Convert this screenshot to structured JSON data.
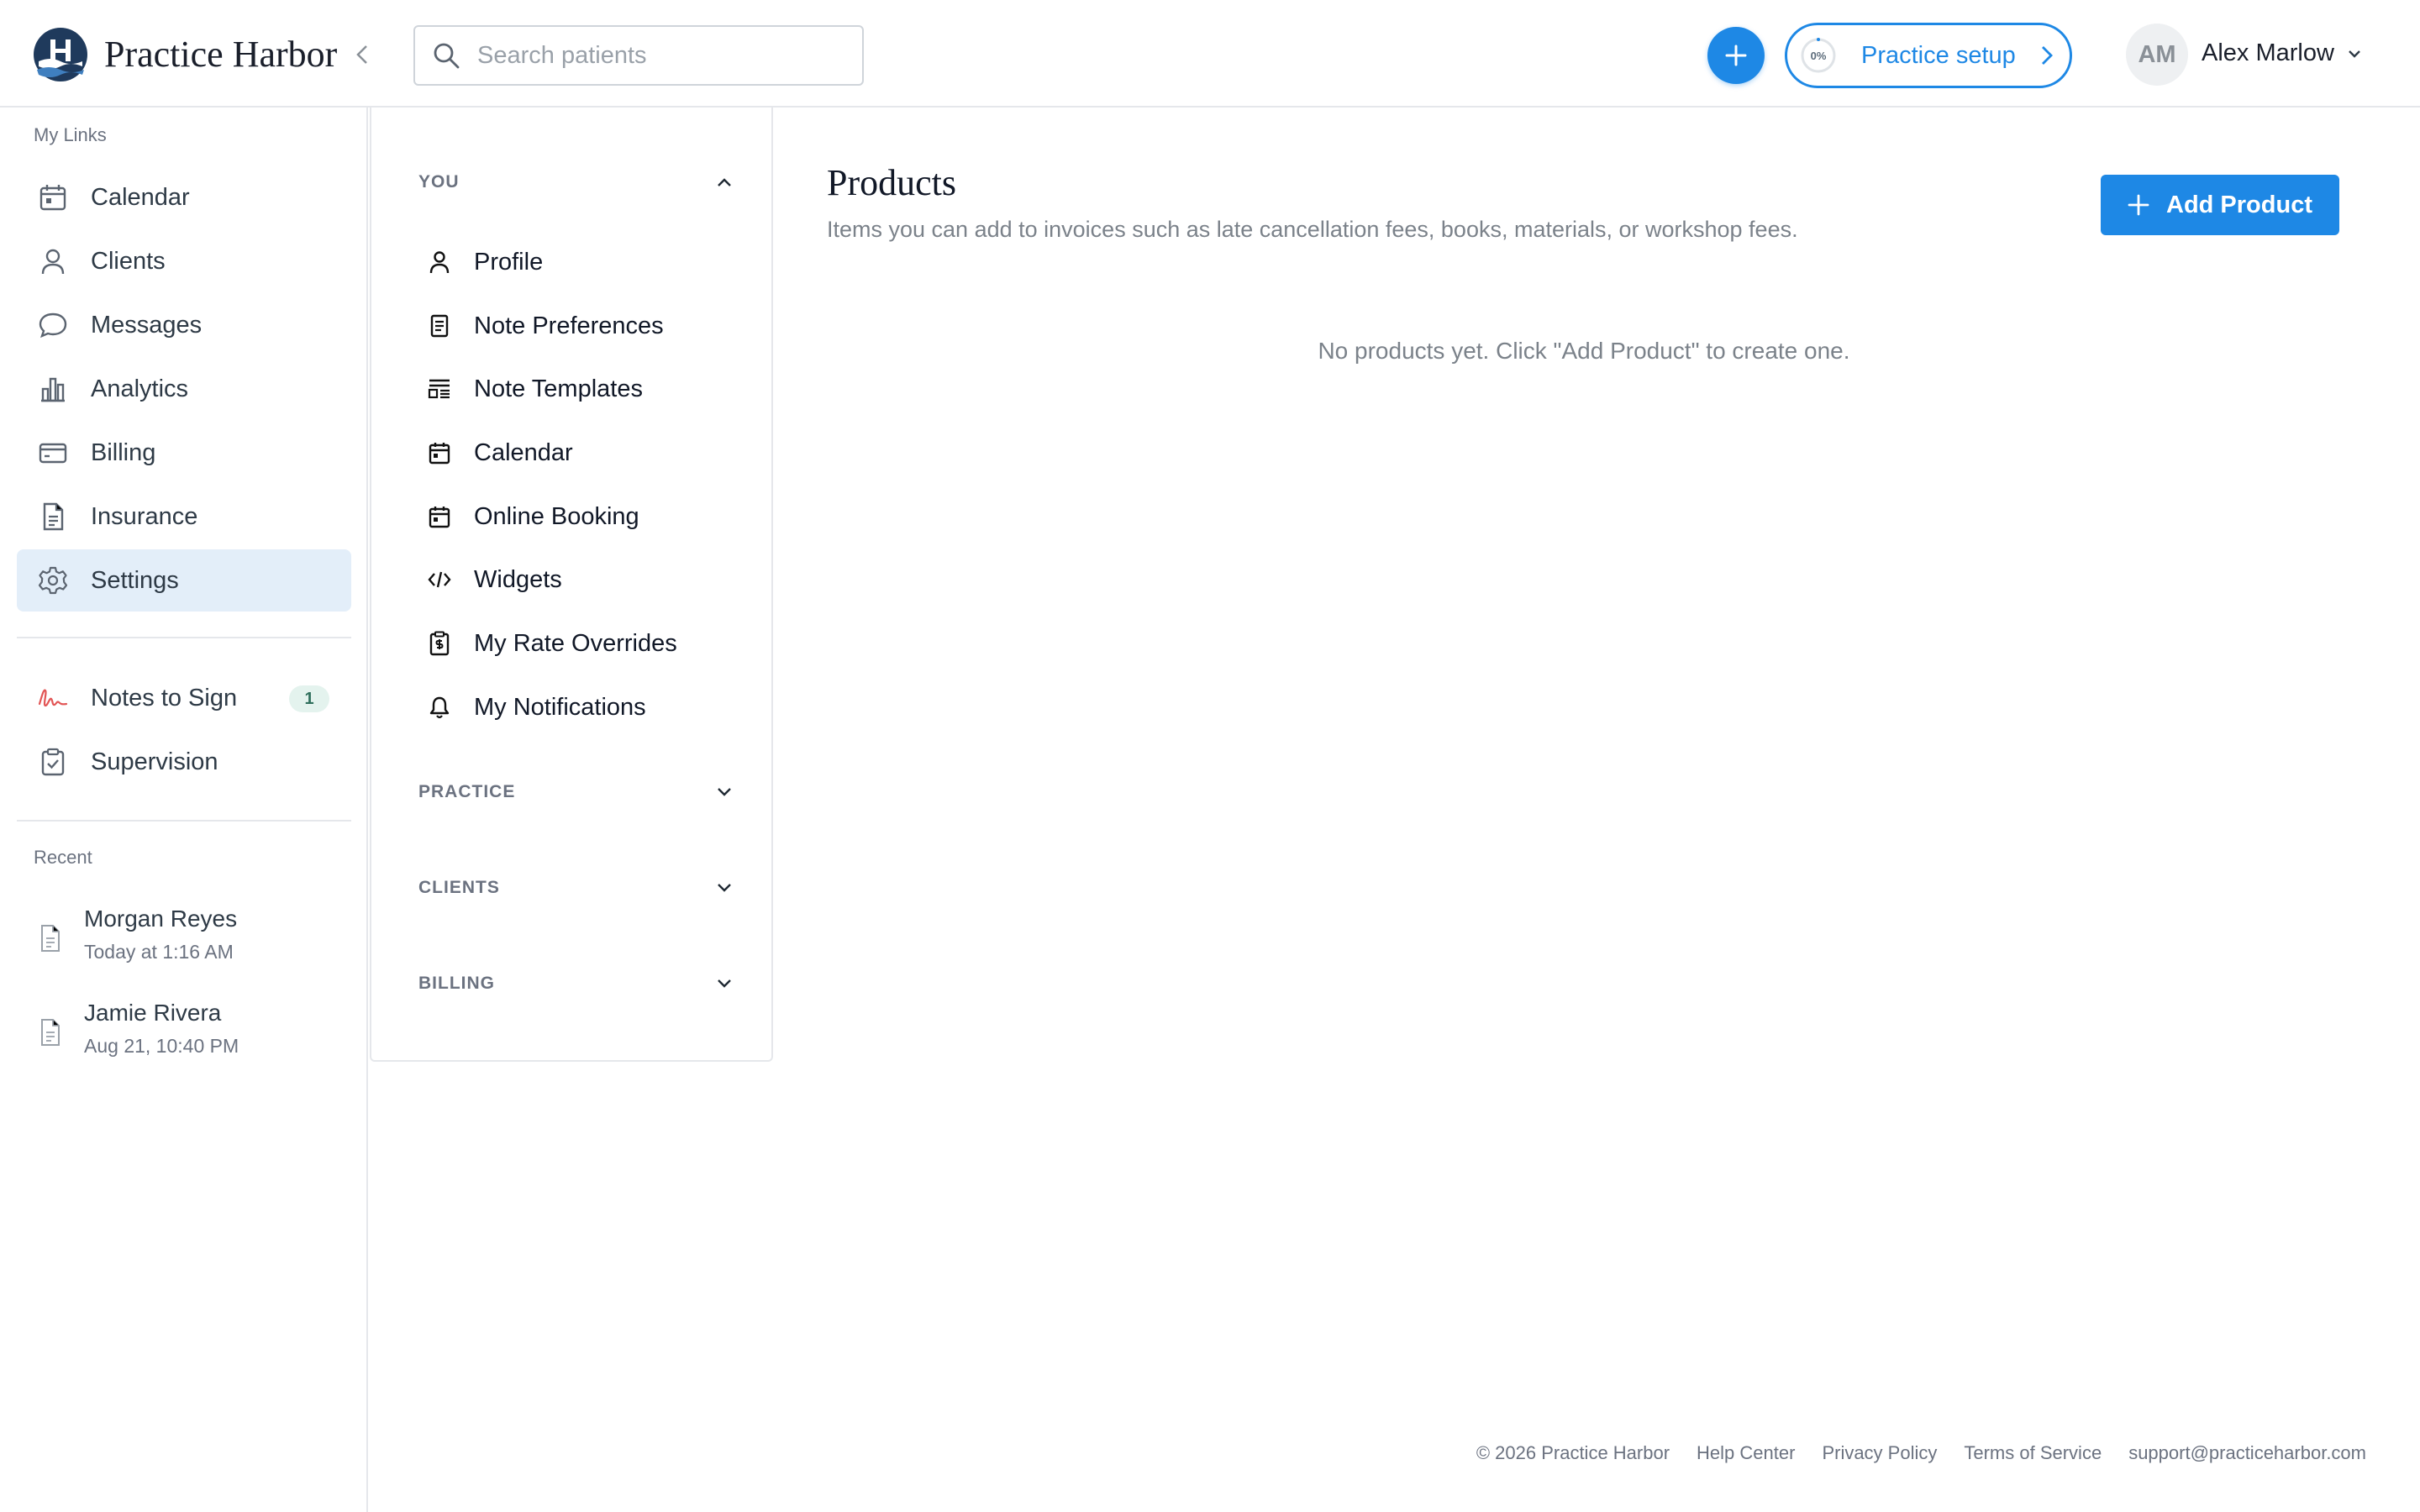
{
  "app": {
    "brand": "Practice Harbor"
  },
  "header": {
    "search_placeholder": "Search patients",
    "setup": {
      "progress_label": "0%",
      "progress_value": 0,
      "label": "Practice setup"
    },
    "user": {
      "initials": "AM",
      "name": "Alex Marlow"
    }
  },
  "sidebar": {
    "my_links_title": "My Links",
    "items": [
      {
        "label": "Calendar",
        "icon": "calendar-icon"
      },
      {
        "label": "Clients",
        "icon": "user-icon"
      },
      {
        "label": "Messages",
        "icon": "chat-bubble-icon"
      },
      {
        "label": "Analytics",
        "icon": "bar-chart-icon"
      },
      {
        "label": "Billing",
        "icon": "credit-card-icon"
      },
      {
        "label": "Insurance",
        "icon": "document-icon"
      },
      {
        "label": "Settings",
        "icon": "gear-icon",
        "active": true
      }
    ],
    "secondary_items": [
      {
        "label": "Notes to Sign",
        "icon": "signature-icon",
        "badge": "1"
      },
      {
        "label": "Supervision",
        "icon": "clipboard-check-icon"
      }
    ],
    "recent_title": "Recent",
    "recent": [
      {
        "name": "Morgan Reyes",
        "time": "Today at 1:16 AM"
      },
      {
        "name": "Jamie Rivera",
        "time": "Aug 21, 10:40 PM"
      }
    ]
  },
  "settings_menu": {
    "groups": [
      {
        "label": "YOU",
        "expanded": true,
        "items": [
          {
            "label": "Profile",
            "icon": "person-icon"
          },
          {
            "label": "Note Preferences",
            "icon": "note-icon"
          },
          {
            "label": "Note Templates",
            "icon": "template-icon"
          },
          {
            "label": "Calendar",
            "icon": "calendar-icon"
          },
          {
            "label": "Online Booking",
            "icon": "calendar-booking-icon"
          },
          {
            "label": "Widgets",
            "icon": "code-icon"
          },
          {
            "label": "My Rate Overrides",
            "icon": "rate-clipboard-icon"
          },
          {
            "label": "My Notifications",
            "icon": "bell-icon"
          }
        ]
      },
      {
        "label": "PRACTICE",
        "expanded": false
      },
      {
        "label": "CLIENTS",
        "expanded": false
      },
      {
        "label": "BILLING",
        "expanded": false
      }
    ]
  },
  "main": {
    "title": "Products",
    "subtitle": "Items you can add to invoices such as late cancellation fees, books, materials, or workshop fees.",
    "add_button_label": "Add Product",
    "empty_message": "No products yet. Click \"Add Product\" to create one."
  },
  "footer": {
    "copyright": "© 2026 Practice Harbor",
    "links": [
      "Help Center",
      "Privacy Policy",
      "Terms of Service"
    ],
    "email": "support@practiceharbor.com"
  },
  "colors": {
    "accent": "#1e88e5",
    "active_nav_bg": "#e3eef9",
    "badge_bg": "#e4f3ee",
    "signature_red": "#e25555"
  }
}
